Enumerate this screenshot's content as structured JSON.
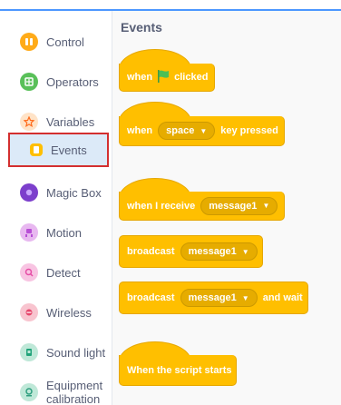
{
  "sidebar": {
    "items": [
      {
        "label": "Control",
        "icon": "control-icon",
        "color": "#ffab19"
      },
      {
        "label": "Operators",
        "icon": "operators-icon",
        "color": "#59c059"
      },
      {
        "label": "Variables",
        "icon": "variables-icon",
        "color": "#ff8c1a"
      },
      {
        "label": "Events",
        "icon": "events-icon",
        "color": "#ffbf00",
        "selected": true
      },
      {
        "label": "Magic Box",
        "icon": "magic-box-icon",
        "color": "#7c3fcc"
      },
      {
        "label": "Motion",
        "icon": "motion-icon",
        "color": "#b84fd6"
      },
      {
        "label": "Detect",
        "icon": "detect-icon",
        "color": "#e64da6"
      },
      {
        "label": "Wireless",
        "icon": "wireless-icon",
        "color": "#e6456b"
      },
      {
        "label": "Sound light",
        "icon": "sound-light-icon",
        "color": "#21a37a"
      },
      {
        "label": "Equipment",
        "label_line2": "calibration",
        "icon": "equipment-calibration-icon",
        "color": "#2e9e7e"
      }
    ]
  },
  "workspace": {
    "title": "Events",
    "blocks": {
      "when_flag": {
        "prefix": "when",
        "suffix": "clicked"
      },
      "when_key": {
        "prefix": "when",
        "key": "space",
        "suffix": "key pressed"
      },
      "when_receive": {
        "prefix": "when I receive",
        "message": "message1"
      },
      "broadcast": {
        "prefix": "broadcast",
        "message": "message1"
      },
      "broadcast_wait": {
        "prefix": "broadcast",
        "message": "message1",
        "suffix": "and wait"
      },
      "script_starts": {
        "label": "When the script starts"
      }
    },
    "dropdown_glyph": "▼"
  },
  "colors": {
    "accent": "#4c97ff",
    "events_block": "#ffbf00",
    "selected_bg": "#dceaf8",
    "selected_border": "#d32f2f",
    "flag": "#4cbf56"
  }
}
